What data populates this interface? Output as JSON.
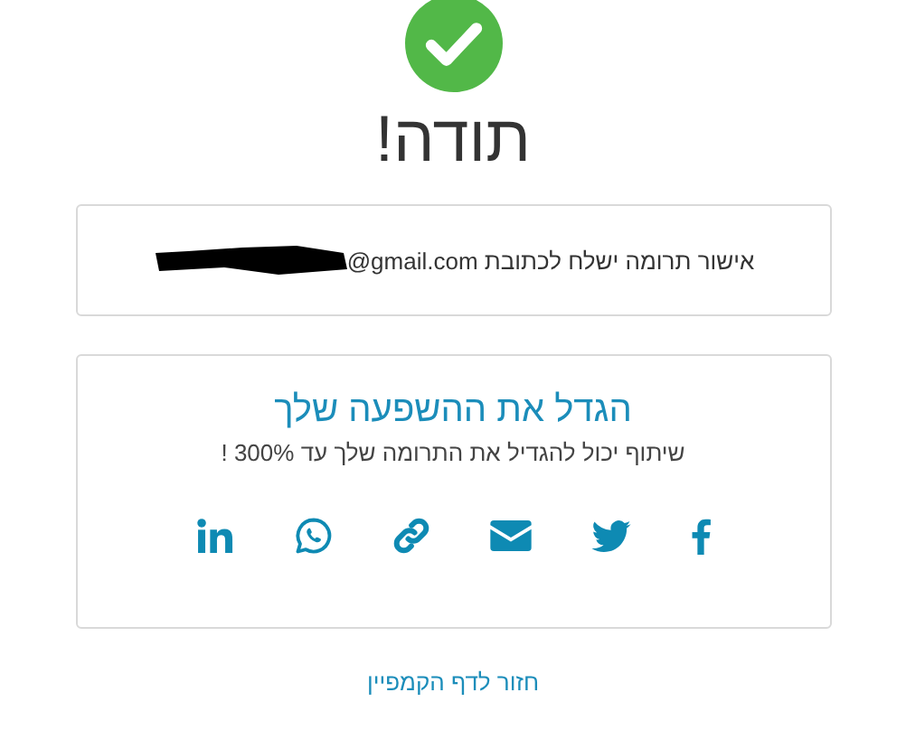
{
  "title": "תודה!",
  "confirmation": {
    "text": "אישור תרומה ישלח לכתובת",
    "email": "@gmail.com",
    "redacted": true
  },
  "share": {
    "heading": "הגדל את ההשפעה שלך",
    "subtitle": "שיתוף יכול להגדיל את התרומה שלך עד 300% !",
    "buttons": [
      {
        "kind": "facebook"
      },
      {
        "kind": "twitter"
      },
      {
        "kind": "email"
      },
      {
        "kind": "link"
      },
      {
        "kind": "whatsapp"
      },
      {
        "kind": "linkedin"
      }
    ]
  },
  "back_link": "חזור לדף הקמפיין"
}
